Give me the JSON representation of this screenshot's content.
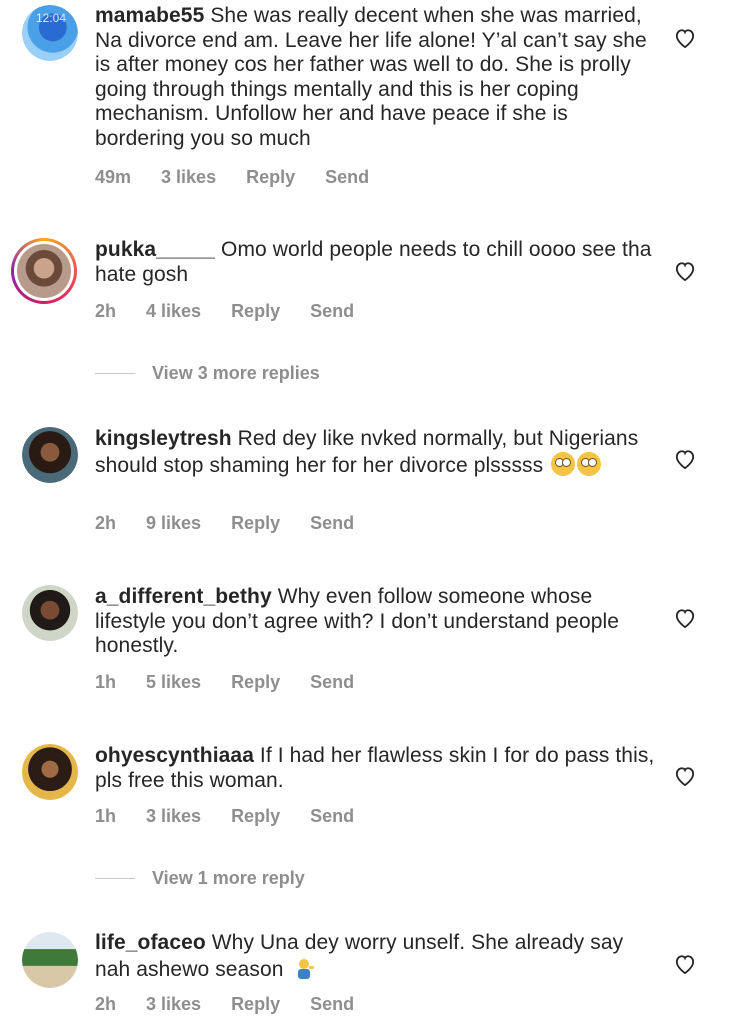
{
  "comments": [
    {
      "username": "mamabe55",
      "text": "She was really decent when she was married, Na divorce end am. Leave her life alone! Y’al can’t say she is after money cos her father was well to do. She is prolly going through things mentally and this is her coping mechanism. Unfollow her and have peace if she is bordering you so much",
      "time": "49m",
      "likes": "3 likes",
      "reply": "Reply",
      "send": "Send"
    },
    {
      "username": "pukka_____",
      "text": "Omo world people needs to chill oooo see tha hate gosh",
      "time": "2h",
      "likes": "4 likes",
      "reply": "Reply",
      "send": "Send",
      "view_replies": "View 3 more replies"
    },
    {
      "username": "kingsleytresh",
      "text": "Red dey like nvked normally, but Nigerians should stop shaming her for her divorce plsssss",
      "emoji": "face-with-rolling-eyes x2",
      "time": "2h",
      "likes": "9 likes",
      "reply": "Reply",
      "send": "Send"
    },
    {
      "username": "a_different_bethy",
      "text": "Why even follow someone whose lifestyle you don’t agree with? I don’t understand people honestly.",
      "time": "1h",
      "likes": "5 likes",
      "reply": "Reply",
      "send": "Send"
    },
    {
      "username": "ohyescynthiaaa",
      "text": "If I had her flawless skin I for do pass this, pls free this woman.",
      "time": "1h",
      "likes": "3 likes",
      "reply": "Reply",
      "send": "Send",
      "view_replies": "View 1 more reply"
    },
    {
      "username": "life_ofaceo",
      "text": "Why Una dey worry unself. She already say nah ashewo season",
      "emoji": "person-tipping-hand",
      "time": "2h",
      "likes": "3 likes",
      "reply": "Reply",
      "send": "Send"
    }
  ],
  "status_time_overlay": "12:04",
  "colors": {
    "text": "#262626",
    "meta": "#8e8e8e",
    "story_ring": "#d81b60"
  }
}
